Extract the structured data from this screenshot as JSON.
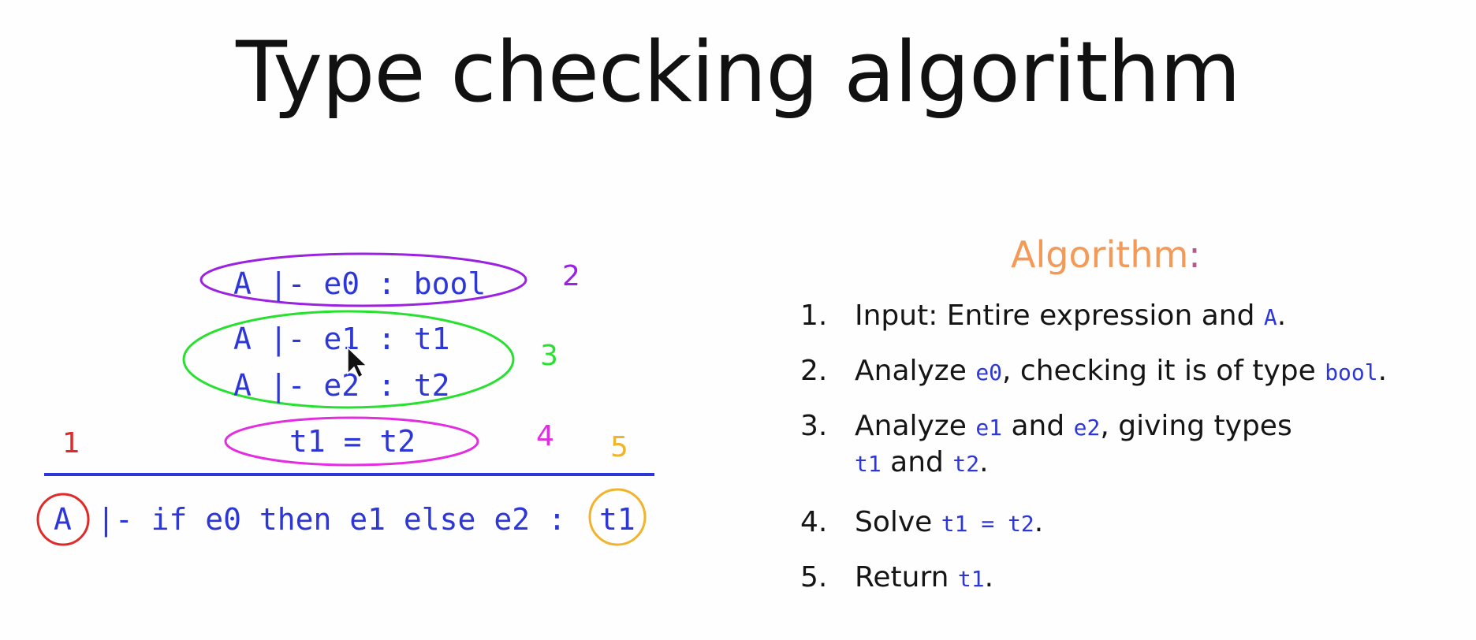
{
  "title": "Type checking algorithm",
  "rule": {
    "premises": [
      {
        "text": "A |- e0 : bool",
        "marker": "2",
        "color": "#9a22e0"
      },
      {
        "text": "A |- e1 : t1",
        "marker": "3",
        "color": "#27e030"
      },
      {
        "text": "A |- e2 : t2"
      },
      {
        "text": "t1 = t2",
        "marker": "4",
        "color": "#e22ee0"
      }
    ],
    "conclusion_env": "A",
    "conclusion_middle": "|- if e0 then e1 else e2 :",
    "conclusion_type": "t1",
    "marker_env": "1",
    "marker_result": "5",
    "colors": {
      "code": "#2d36d6",
      "rule_line": "#2d36d6",
      "env_circle": "#e02a2a",
      "result_circle": "#f0b32a"
    }
  },
  "algorithm": {
    "heading": "Algorithm",
    "heading_colon": ":",
    "heading_color": "#f39a58",
    "steps": [
      {
        "num": "1.",
        "pre": "Input: Entire expression and ",
        "c1": "A",
        "post": "."
      },
      {
        "num": "2.",
        "pre": "Analyze ",
        "c1": "e0",
        "mid": ", checking it is of type ",
        "c2": "bool",
        "post": "."
      },
      {
        "num": "3.",
        "pre": "Analyze ",
        "c1": "e1",
        "mid": " and ",
        "c2": "e2",
        "post": ", giving types",
        "line2_c1": "t1",
        "line2_mid": " and ",
        "line2_c2": "t2",
        "line2_post": "."
      },
      {
        "num": "4.",
        "pre": "Solve ",
        "c1": "t1 = t2",
        "post": "."
      },
      {
        "num": "5.",
        "pre": "Return ",
        "c1": "t1",
        "post": "."
      }
    ]
  }
}
